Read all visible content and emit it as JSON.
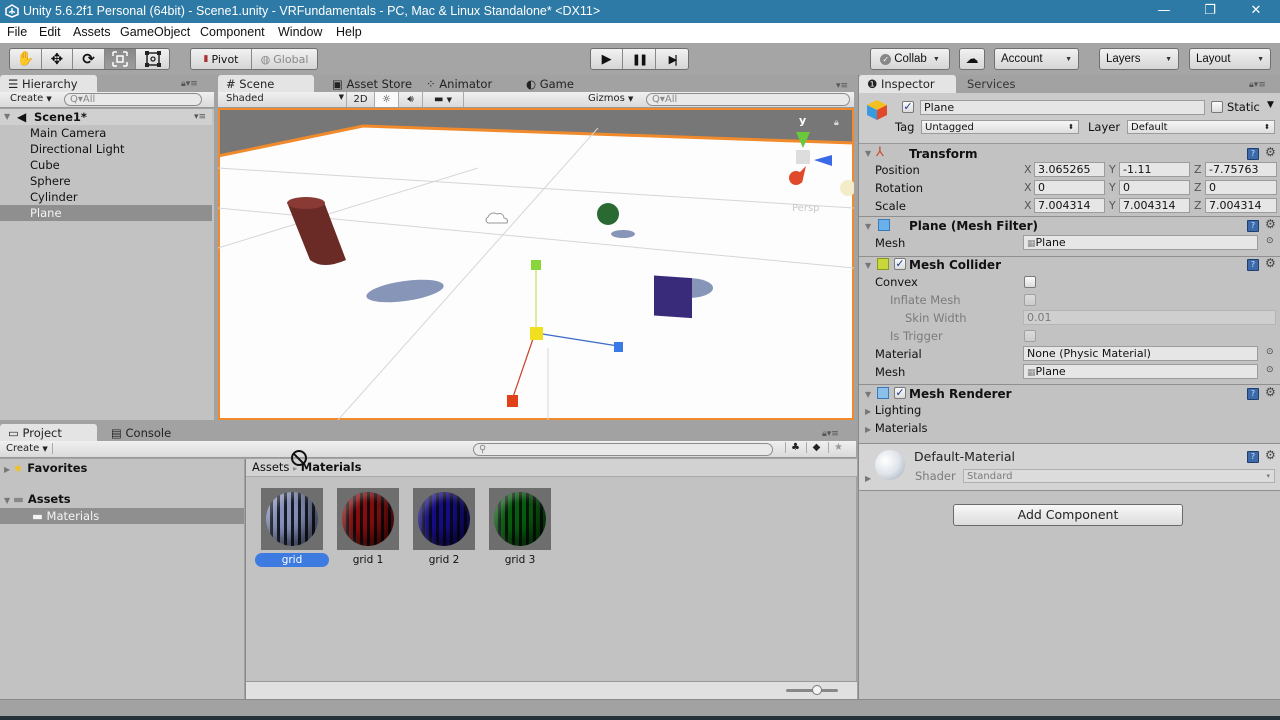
{
  "window": {
    "title": "Unity 5.6.2f1 Personal (64bit) - Scene1.unity - VRFundamentals - PC, Mac & Linux Standalone* <DX11>",
    "controls": {
      "minimize": "—",
      "restore": "❐",
      "close": "✕"
    }
  },
  "menu": [
    "File",
    "Edit",
    "Assets",
    "GameObject",
    "Component",
    "Window",
    "Help"
  ],
  "toolbar": {
    "tools": [
      "hand-tool",
      "move-tool",
      "rotate-tool",
      "scale-tool",
      "rect-tool"
    ],
    "active_tool": "scale-tool",
    "pivot_label": "Pivot",
    "global_label": "Global",
    "play_icons": {
      "play": "▶",
      "pause": "❚❚",
      "step": "▶|"
    },
    "collab_label": "Collab",
    "account_label": "Account",
    "layers_label": "Layers",
    "layout_label": "Layout"
  },
  "hierarchy": {
    "tab_label": "Hierarchy",
    "create_label": "Create",
    "search_placeholder": "Q▾All",
    "scene_name": "Scene1*",
    "items": [
      "Main Camera",
      "Directional Light",
      "Cube",
      "Sphere",
      "Cylinder",
      "Plane"
    ],
    "selected": "Plane"
  },
  "scene_view": {
    "tabs": [
      "Scene",
      "Asset Store",
      "Animator",
      "Game"
    ],
    "active_tab": "Scene",
    "shading_mode": "Shaded",
    "mode_2d_label": "2D",
    "gizmos_label": "Gizmos",
    "search_placeholder": "Q▾All",
    "gizmo_axis_label": "y",
    "projection_label": "Persp"
  },
  "inspector": {
    "tabs": [
      "Inspector",
      "Services"
    ],
    "active_tab": "Inspector",
    "object_name": "Plane",
    "active": true,
    "static_label": "Static",
    "tag_label": "Tag",
    "tag_value": "Untagged",
    "layer_label": "Layer",
    "layer_value": "Default",
    "transform": {
      "title": "Transform",
      "rows": [
        {
          "label": "Position",
          "x": "3.065265",
          "y": "-1.11",
          "z": "-7.75763"
        },
        {
          "label": "Rotation",
          "x": "0",
          "y": "0",
          "z": "0"
        },
        {
          "label": "Scale",
          "x": "7.004314",
          "y": "7.004314",
          "z": "7.004314"
        }
      ]
    },
    "mesh_filter": {
      "title": "Plane (Mesh Filter)",
      "mesh_label": "Mesh",
      "mesh_value": "Plane"
    },
    "mesh_collider": {
      "title": "Mesh Collider",
      "enabled": true,
      "convex_label": "Convex",
      "inflate_label": "Inflate Mesh",
      "skin_label": "Skin Width",
      "skin_value": "0.01",
      "trigger_label": "Is Trigger",
      "material_label": "Material",
      "material_value": "None (Physic Material)",
      "mesh_label": "Mesh",
      "mesh_value": "Plane"
    },
    "mesh_renderer": {
      "title": "Mesh Renderer",
      "enabled": true,
      "lighting_label": "Lighting",
      "materials_label": "Materials"
    },
    "material": {
      "name": "Default-Material",
      "shader_label": "Shader",
      "shader_value": "Standard"
    },
    "add_component_label": "Add Component"
  },
  "project": {
    "tabs": [
      "Project",
      "Console"
    ],
    "active_tab": "Project",
    "create_label": "Create",
    "tree": {
      "favorites": "Favorites",
      "assets": "Assets",
      "materials": "Materials"
    },
    "breadcrumb": [
      "Assets",
      "Materials"
    ],
    "assets": [
      {
        "name": "grid",
        "color": "#b8bfd8",
        "selected": true
      },
      {
        "name": "grid 1",
        "color": "#b83a3a",
        "selected": false
      },
      {
        "name": "grid 2",
        "color": "#4a3ab8",
        "selected": false
      },
      {
        "name": "grid 3",
        "color": "#2e9a3a",
        "selected": false
      }
    ]
  },
  "colors": {
    "title_bar": "#2d7aa6",
    "selection_blue": "#3d7be0",
    "scene_border": "#f08a2a"
  }
}
